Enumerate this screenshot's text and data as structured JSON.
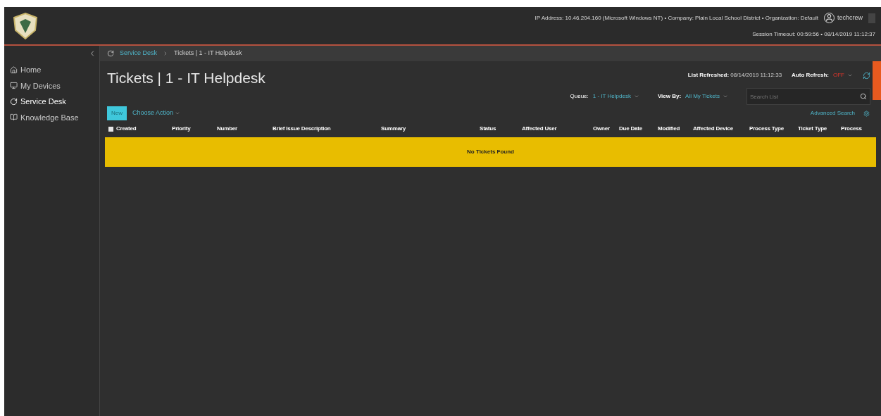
{
  "header": {
    "info": "IP Address: 10.46.204.160 (Microsoft Windows NT) • Company: Plain Local School District • Organization: Default",
    "user": "techcrew",
    "session": "Session Timeout: 00:59:56 • 08/14/2019 11:12:37"
  },
  "sidebar": {
    "items": [
      {
        "label": "Home",
        "selected": false
      },
      {
        "label": "My Devices",
        "selected": false
      },
      {
        "label": "Service Desk",
        "selected": true
      },
      {
        "label": "Knowledge Base",
        "selected": false
      }
    ]
  },
  "breadcrumb": [
    "Service Desk",
    "Tickets | 1 - IT Helpdesk"
  ],
  "title": "Tickets | 1 - IT Helpdesk",
  "list_refreshed": {
    "label": "List Refreshed:",
    "value": "08/14/2019 11:12:33"
  },
  "auto_refresh": {
    "label": "Auto Refresh:",
    "value": "OFF",
    "on": false
  },
  "queue": {
    "label": "Queue:",
    "value": "1 - IT Helpdesk"
  },
  "view_by": {
    "label": "View By:",
    "value": "All My Tickets"
  },
  "search": {
    "placeholder": "Search List"
  },
  "actions": {
    "new": "New",
    "choose": "Choose Action",
    "advanced": "Advanced Search"
  },
  "table": {
    "columns": [
      "Created",
      "Priority",
      "Number",
      "Brief Issue Description",
      "Summary",
      "Status",
      "Affected User",
      "Owner",
      "Due Date",
      "Modified",
      "Affected Device",
      "Process Type",
      "Ticket Type",
      "Process"
    ],
    "select_all_checked": false,
    "empty": "No Tickets Found"
  }
}
